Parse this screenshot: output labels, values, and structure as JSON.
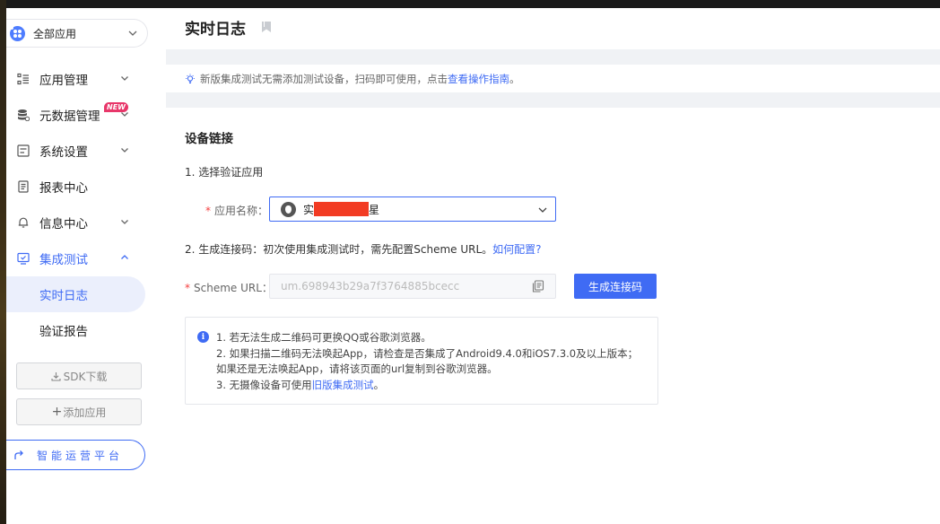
{
  "sidebar": {
    "app_selector": "全部应用",
    "items": [
      {
        "label": "应用管理"
      },
      {
        "label": "元数据管理",
        "badge": "NEW"
      },
      {
        "label": "系统设置"
      },
      {
        "label": "报表中心"
      },
      {
        "label": "信息中心"
      },
      {
        "label": "集成测试"
      }
    ],
    "sub_items": [
      {
        "label": "实时日志"
      },
      {
        "label": "验证报告"
      }
    ],
    "sdk_button": "SDK下载",
    "add_app_button": "添加应用",
    "platform_button": "智能运营平台"
  },
  "header": {
    "title": "实时日志"
  },
  "notice": {
    "text": "新版集成测试无需添加测试设备，扫码即可使用，点击 ",
    "link": "查看操作指南",
    "suffix": "。"
  },
  "card": {
    "title": "设备链接",
    "step1": "1. 选择验证应用",
    "app_name_label": "应用名称：",
    "app_name_prefix": "实",
    "app_name_suffix": "星",
    "step2_text": "2. 生成连接码：初次使用集成测试时，需先配置Scheme URL。",
    "step2_link": "如何配置?",
    "scheme_label": "Scheme URL：",
    "scheme_value": "um.698943b29a7f3764885bcecc",
    "generate_button": "生成连接码",
    "info": {
      "line1": "1. 若无法生成二维码可更换QQ或谷歌浏览器。",
      "line2": "2. 如果扫描二维码无法唤起App，请检查是否集成了Android9.4.0和iOS7.3.0及以上版本；",
      "line3": "如果还是无法唤起App，请将该页面的url复制到谷歌浏览器。",
      "line4_text": "3. 无摄像设备可使用",
      "line4_link": "旧版集成测试",
      "line4_suffix": "。"
    }
  },
  "colors": {
    "accent": "#3f6bf4",
    "badge": "#e8376a",
    "redaction": "#f23b23"
  }
}
